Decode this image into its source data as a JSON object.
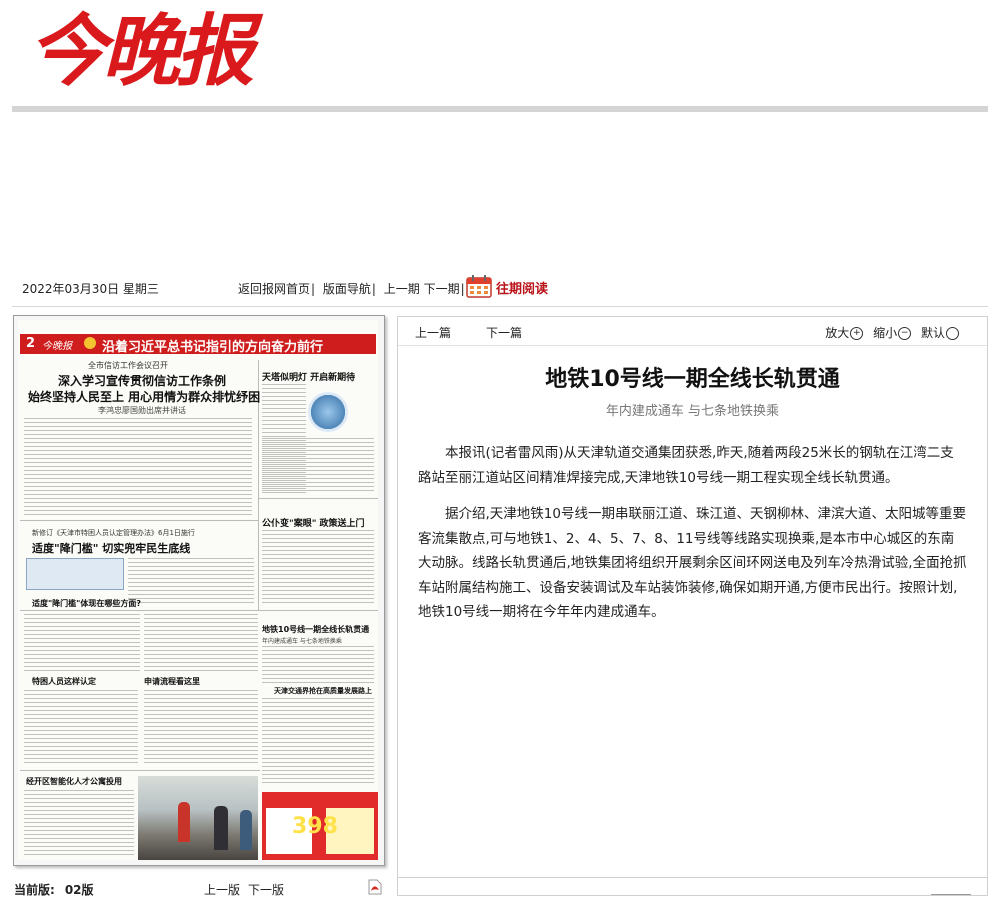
{
  "masthead": {
    "logo": "今晚报"
  },
  "date_bar": {
    "date": "2022年03月30日 星期三",
    "links": [
      "返回报网首页",
      "版面导航",
      "上一期",
      "下一期"
    ],
    "archive_label": "往期阅读"
  },
  "paper_page": {
    "page_number": "2",
    "section_title": "沿着习近平总书记指引的方向奋力前行",
    "headlines": {
      "kicker": "全市信访工作会议召开",
      "lead1": "深入学习宣传贯彻信访工作条例",
      "lead2": "始终坚持人民至上 用心用情为群众排忧纾困",
      "lead_sub": "李鸿忠廖国勋出席并讲话",
      "right_top": "天塔似明灯 开启新期待",
      "right_mid": "公仆变\"案眼\" 政策送上门",
      "kicker2": "新修订《天津市特困人员认定管理办法》6月1日施行",
      "mid_title": "适度\"降门槛\" 切实兜牢民生底线",
      "q_title": "适度\"降门槛\"体现在哪些方面?",
      "metro": "地铁10号线一期全线长轨贯通",
      "metro_sub": "年内建成通车 与七条地铁换乘",
      "traffic": "天津交通界抢在高质量发展路上",
      "who": "特困人员这样认定",
      "flow": "申请流程看这里",
      "bottom": "经开区智能化人才公寓投用",
      "ad_number": "398"
    }
  },
  "page_info": {
    "label": "当前版:",
    "value": "02版"
  },
  "bottom_nav": [
    "上一版",
    "下一版"
  ],
  "article": {
    "toolbar": {
      "prev": "上一篇",
      "next": "下一篇",
      "zoom_in": "放大",
      "zoom_out": "缩小",
      "default": "默认"
    },
    "title": "地铁10号线一期全线长轨贯通",
    "subtitle": "年内建成通车 与七条地铁换乘",
    "paragraphs": [
      "本报讯(记者雷风雨)从天津轨道交通集团获悉,昨天,随着两段25米长的钢轨在江湾二支路站至丽江道站区间精准焊接完成,天津地铁10号线一期工程实现全线长轨贯通。",
      "据介绍,天津地铁10号线一期串联丽江道、珠江道、天钢柳林、津滨大道、太阳城等重要客流集散点,可与地铁1、2、4、5、7、8、11号线等线路实现换乘,是本市中心城区的东南大动脉。线路长轨贯通后,地铁集团将组织开展剩余区间环网送电及列车冷热滑试验,全面抢抓车站附属结构施工、设备安装调试及车站装饰装修,确保如期开通,方便市民出行。按照计划,地铁10号线一期将在今年年内建成通车。"
    ]
  }
}
